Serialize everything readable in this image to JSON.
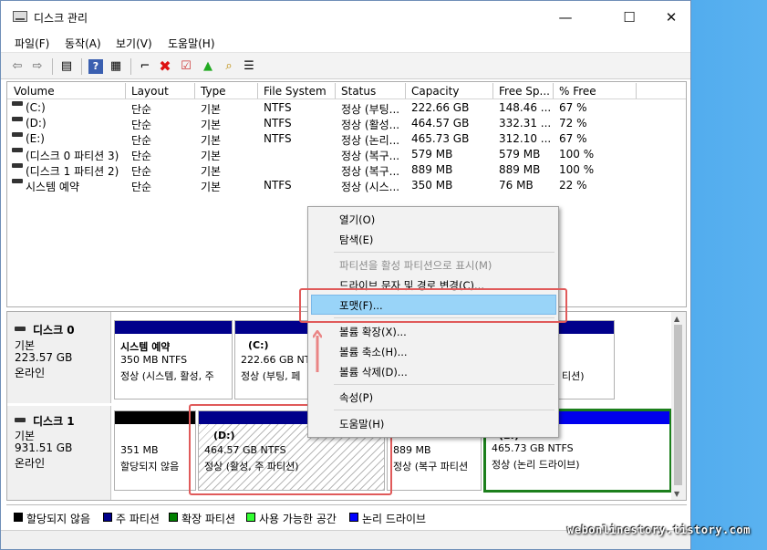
{
  "window": {
    "title": "디스크 관리",
    "controls": {
      "minimize": "—",
      "maximize": "☐",
      "close": "✕"
    }
  },
  "menu": [
    "파일(F)",
    "동작(A)",
    "보기(V)",
    "도움말(H)"
  ],
  "toolbar_icons": [
    "back-icon",
    "forward-icon",
    "console-icon",
    "help-icon",
    "properties-icon",
    "connect-icon",
    "delete-icon",
    "check-icon",
    "up-icon",
    "search-icon",
    "list-icon"
  ],
  "volume_list": {
    "columns": [
      "Volume",
      "Layout",
      "Type",
      "File System",
      "Status",
      "Capacity",
      "Free Sp...",
      "% Free"
    ],
    "rows": [
      [
        "(C:)",
        "단순",
        "기본",
        "NTFS",
        "정상 (부팅...",
        "222.66 GB",
        "148.46 ...",
        "67 %"
      ],
      [
        "(D:)",
        "단순",
        "기본",
        "NTFS",
        "정상 (활성...",
        "464.57 GB",
        "332.31 ...",
        "72 %"
      ],
      [
        "(E:)",
        "단순",
        "기본",
        "NTFS",
        "정상 (논리...",
        "465.73 GB",
        "312.10 ...",
        "67 %"
      ],
      [
        "(디스크 0 파티션 3)",
        "단순",
        "기본",
        "",
        "정상 (복구...",
        "579 MB",
        "579 MB",
        "100 %"
      ],
      [
        "(디스크 1 파티션 2)",
        "단순",
        "기본",
        "",
        "정상 (복구...",
        "889 MB",
        "889 MB",
        "100 %"
      ],
      [
        "시스템 예약",
        "단순",
        "기본",
        "NTFS",
        "정상 (시스...",
        "350 MB",
        "76 MB",
        "22 %"
      ]
    ]
  },
  "disks": [
    {
      "name": "디스크 0",
      "type": "기본",
      "size": "223.57 GB",
      "state": "온라인",
      "partitions": [
        {
          "title": "시스템 예약",
          "line1": "350 MB NTFS",
          "line2": "정상 (시스템, 활성, 주"
        },
        {
          "title": "(C:)",
          "line1": "222.66 GB NTFS",
          "line2": "정상 (부팅, 페"
        },
        {
          "title": "",
          "line1": "",
          "line2": "티션)"
        }
      ]
    },
    {
      "name": "디스크 1",
      "type": "기본",
      "size": "931.51 GB",
      "state": "온라인",
      "partitions": [
        {
          "title": "",
          "line1": "351 MB",
          "line2": "할당되지 않음"
        },
        {
          "title": "(D:)",
          "line1": "464.57 GB NTFS",
          "line2": "정상 (활성, 주 파티션)"
        },
        {
          "title": "",
          "line1": "889 MB",
          "line2": "정상 (복구 파티션"
        },
        {
          "title": "(E:)",
          "line1": "465.73 GB NTFS",
          "line2": "정상 (논리 드라이브)"
        }
      ]
    }
  ],
  "legend": [
    {
      "label": "할당되지 않음",
      "color": "#000000"
    },
    {
      "label": "주 파티션",
      "color": "#00008b"
    },
    {
      "label": "확장 파티션",
      "color": "#008000"
    },
    {
      "label": "사용 가능한 공간",
      "color": "#33ff33"
    },
    {
      "label": "논리 드라이브",
      "color": "#0000ff"
    }
  ],
  "context_menu": {
    "items": [
      {
        "label": "열기(O)",
        "enabled": true
      },
      {
        "label": "탐색(E)",
        "enabled": true
      },
      {
        "label": "파티션을 활성 파티션으로 표시(M)",
        "enabled": false
      },
      {
        "label": "드라이브 문자 및 경로 변경(C)...",
        "enabled": true
      },
      {
        "label": "포맷(F)...",
        "enabled": true,
        "highlighted": true
      },
      {
        "label": "볼륨 확장(X)...",
        "enabled": true
      },
      {
        "label": "볼륨 축소(H)...",
        "enabled": true
      },
      {
        "label": "볼륨 삭제(D)...",
        "enabled": true
      },
      {
        "label": "속성(P)",
        "enabled": true
      },
      {
        "label": "도움말(H)",
        "enabled": true
      }
    ]
  },
  "watermark": "webonlinestory.tistory.com"
}
